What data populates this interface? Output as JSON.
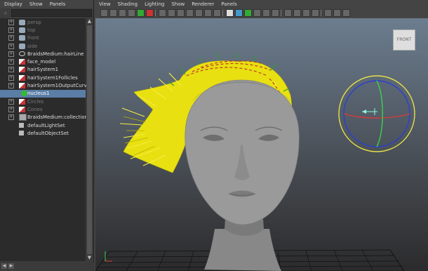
{
  "outliner": {
    "menu": [
      "Display",
      "Show",
      "Panels"
    ],
    "items": [
      {
        "label": "persp",
        "icon": "camera-icon",
        "dim": true
      },
      {
        "label": "top",
        "icon": "camera-icon",
        "dim": true
      },
      {
        "label": "front",
        "icon": "camera-icon",
        "dim": true
      },
      {
        "label": "side",
        "icon": "camera-icon",
        "dim": true
      },
      {
        "label": "BraidsMedium:hairLine",
        "icon": "curve-icon",
        "dim": false
      },
      {
        "label": "face_model",
        "icon": "mesh-icon",
        "dim": false
      },
      {
        "label": "hairSystem1",
        "icon": "hair-system-icon",
        "dim": false
      },
      {
        "label": "hairSystem1Follicles",
        "icon": "hair-system-icon",
        "dim": false
      },
      {
        "label": "hairSystem1OutputCurves",
        "icon": "hair-system-icon",
        "dim": false
      },
      {
        "label": "nucleus1",
        "icon": "nucleus-icon",
        "dim": false,
        "selected": true
      },
      {
        "label": "Circles",
        "icon": "hair-system-icon",
        "dim": true
      },
      {
        "label": "Cones",
        "icon": "hair-system-icon",
        "dim": true
      },
      {
        "label": "BraidsMedium:collection5",
        "icon": "collection-icon",
        "dim": false
      },
      {
        "label": "defaultLightSet",
        "icon": "set-icon",
        "dim": false
      },
      {
        "label": "defaultObjectSet",
        "icon": "set-icon",
        "dim": false
      }
    ]
  },
  "viewport": {
    "menu": [
      "View",
      "Shading",
      "Lighting",
      "Show",
      "Renderer",
      "Panels"
    ],
    "viewcube_label": "FRONT",
    "colors": {
      "hair": "#e8e010",
      "hair_guides": "#c0392b",
      "follicles": "#2e9e2e",
      "face": "#9a9a9a",
      "manip_outer": "#e6e04a",
      "manip_blue": "#2d3fcc",
      "manip_red": "#d83a3a",
      "manip_green": "#3bd24b"
    }
  }
}
